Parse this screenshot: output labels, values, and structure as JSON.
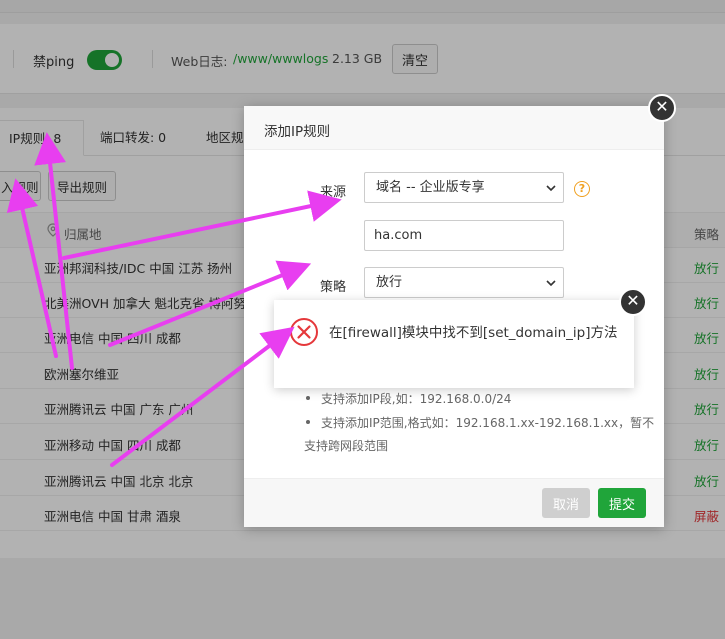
{
  "toolbar": {
    "ping_label": "禁ping",
    "ping_enabled": true,
    "weblog_label": "Web日志:",
    "weblog_path": "/www/wwwlogs",
    "weblog_size": "2.13 GB",
    "clear_label": "清空"
  },
  "tabs": [
    {
      "label": "IP规则:  8",
      "active": true
    },
    {
      "label": "端口转发:  0",
      "active": false
    },
    {
      "label": "地区规",
      "active": false
    }
  ],
  "actions": {
    "import_label": "入规则",
    "export_label": "导出规则"
  },
  "table": {
    "col_location": "归属地",
    "col_policy": "策略",
    "rows": [
      {
        "location": "亚洲邦润科技/IDC 中国 江苏 扬州",
        "policy": "放行",
        "type": "allow"
      },
      {
        "location": "北美洲OVH 加拿大 魁北克省 博阿努瓦",
        "policy": "放行",
        "type": "allow"
      },
      {
        "location": "亚洲电信 中国 四川 成都",
        "policy": "放行",
        "type": "allow"
      },
      {
        "location": "欧洲塞尔维亚",
        "policy": "放行",
        "type": "allow"
      },
      {
        "location": "亚洲腾讯云 中国 广东 广州",
        "policy": "放行",
        "type": "allow"
      },
      {
        "location": "亚洲移动 中国 四川 成都",
        "policy": "放行",
        "type": "allow"
      },
      {
        "location": "亚洲腾讯云 中国 北京 北京",
        "policy": "放行",
        "type": "allow"
      },
      {
        "location": "亚洲电信 中国 甘肃 酒泉",
        "policy": "屏蔽",
        "type": "block"
      }
    ]
  },
  "modal": {
    "title": "添加IP规则",
    "source_label": "来源",
    "source_value": "域名 -- 企业版专享",
    "domain_value": "ha.com",
    "policy_label": "策略",
    "policy_value": "放行",
    "tips": [
      "支持添加IP段,如：192.168.0.0/24",
      "支持添加IP范围,格式如：192.168.1.xx-192.168.1.xx，暂不",
      "支持跨网段范围"
    ],
    "cancel_label": "取消",
    "submit_label": "提交"
  },
  "alert": {
    "message": "在[firewall]模块中找不到[set_domain_ip]方法"
  },
  "colors": {
    "accent_green": "#20a53a",
    "block_red": "#e5383b",
    "error_red": "#e5383b",
    "annotation_magenta": "#e83ef0",
    "help_orange": "#f0a020"
  }
}
